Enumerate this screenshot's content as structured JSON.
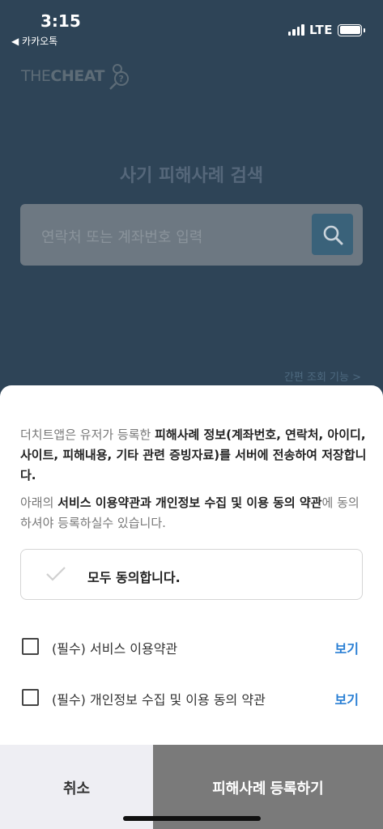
{
  "status_bar": {
    "time": "3:15",
    "back_app": "◀ 카카오톡",
    "network": "LTE"
  },
  "background": {
    "logo_prefix": "THE",
    "logo_bold": "CHEAT",
    "search_title": "사기 피해사례 검색",
    "search_placeholder": "연락처 또는 계좌번호 입력",
    "quick_link": "간편 조회 기능 >"
  },
  "sheet": {
    "notice1": {
      "pre": "더치트앱은 유저가 등록한 ",
      "bold": "피해사례 정보(계좌번호, 연락처, 아이디, 사이트, 피해내용, 기타 관련 증빙자료)를 서버에 전송하여 저장합니다."
    },
    "notice2": {
      "pre": "아래의 ",
      "bold": "서비스 이용약관과 개인정보 수집 및 이용 동의 약관",
      "post": "에 동의하셔야 등록하실수 있습니다."
    },
    "agree_all_label": "모두 동의합니다.",
    "terms": [
      {
        "label": "(필수) 서비스 이용약관",
        "view": "보기"
      },
      {
        "label": "(필수) 개인정보 수집 및 이용 동의 약관",
        "view": "보기"
      }
    ],
    "cancel_label": "취소",
    "register_label": "피해사례 등록하기"
  },
  "colors": {
    "link_blue": "#2a7fd4",
    "register_bg": "#7a7a7a",
    "cancel_bg": "#eeeef3",
    "overlay_bg": "#2e4457"
  }
}
